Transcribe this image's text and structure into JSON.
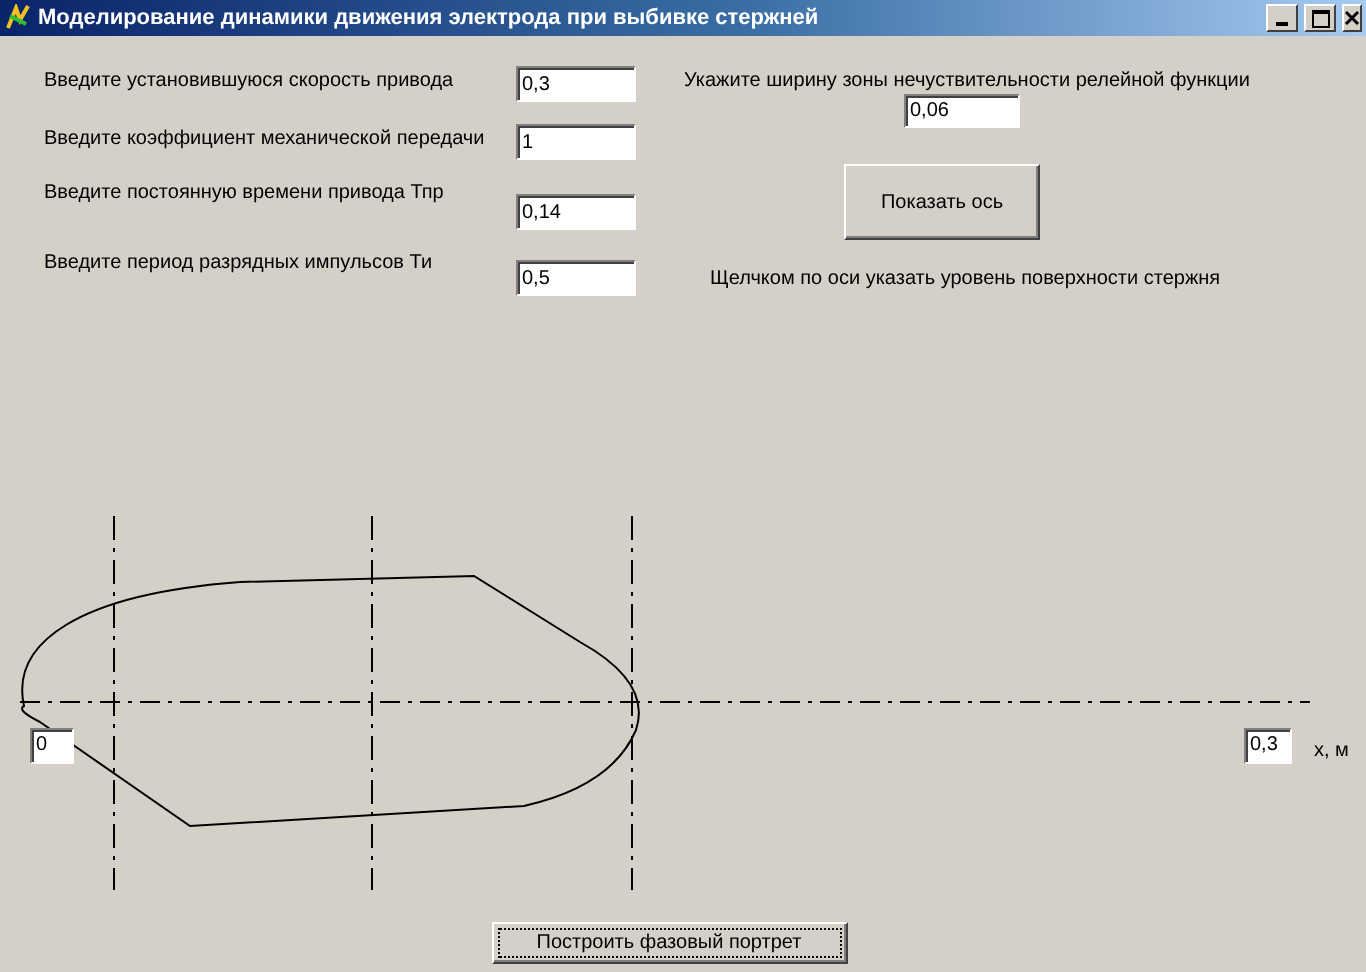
{
  "window": {
    "title": "Моделирование динамики движения электрода при выбивке стержней"
  },
  "inputs": [
    {
      "label": "Введите установившуюся скорость привода",
      "value": "0,3"
    },
    {
      "label": "Введите коэффициент механической передачи",
      "value": "1"
    },
    {
      "label": "Введите постоянную времени привода Тпр",
      "value": "0,14"
    },
    {
      "label": "Введите период разрядных импульсов Ти",
      "value": "0,5"
    }
  ],
  "relay": {
    "label": "Укажите ширину  зоны нечуствительности релейной функции",
    "value": "0,06"
  },
  "show_axis_button": "Показать ось",
  "hint": "Щелчком по оси указать уровень поверхности стержня",
  "plot": {
    "left_value": "0",
    "right_value": "0,3",
    "axis_label": "х, м"
  },
  "build_button": "Построить фазовый портрет"
}
